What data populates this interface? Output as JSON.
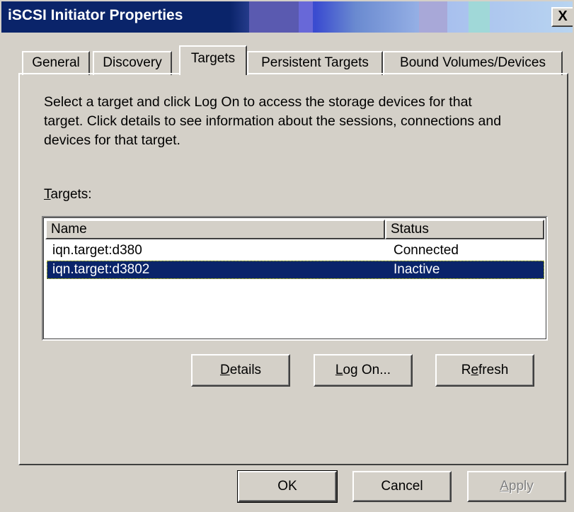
{
  "window": {
    "title": "iSCSI Initiator Properties",
    "close_label": "X"
  },
  "tabs": [
    {
      "label": "General"
    },
    {
      "label": "Discovery"
    },
    {
      "label": "Targets",
      "active": true
    },
    {
      "label": "Persistent Targets"
    },
    {
      "label": "Bound Volumes/Devices"
    }
  ],
  "panel": {
    "description_line1": "Select a target and click Log On to access the storage devices for that",
    "description_line2": "target. Click details to see information about the sessions, connections and",
    "description_line3": "devices for that target.",
    "targets_label_mnemonic": "T",
    "targets_label_rest": "argets:"
  },
  "list": {
    "columns": [
      "Name",
      "Status"
    ],
    "rows": [
      {
        "name": "iqn.target:d380",
        "status": "Connected",
        "selected": false
      },
      {
        "name": "iqn.target:d3802",
        "status": "Inactive",
        "selected": true
      }
    ]
  },
  "actions": {
    "details_mnemonic": "D",
    "details_rest": "etails",
    "logon_mnemonic": "L",
    "logon_rest": "og On...",
    "refresh_pre": "R",
    "refresh_mnemonic": "e",
    "refresh_rest": "fresh"
  },
  "footer": {
    "ok_label": "OK",
    "cancel_label": "Cancel",
    "apply_mnemonic": "A",
    "apply_rest": "pply"
  },
  "colors": {
    "title_dark": "#0a246a",
    "face": "#d4d0c8",
    "selection": "#0a246a"
  }
}
